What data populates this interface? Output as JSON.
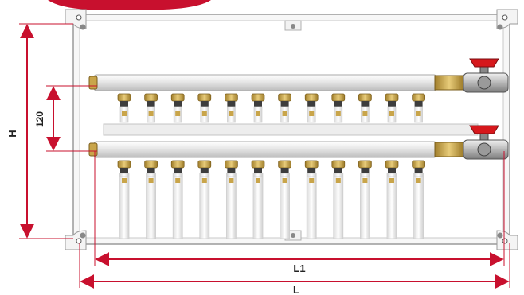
{
  "dimensions": {
    "height_label": "H",
    "spacing_label": "120",
    "inner_length_label": "L1",
    "overall_length_label": "L"
  },
  "colors": {
    "dimension_red": "#c8102e",
    "valve_handle_red": "#d6181c",
    "cabinet_border": "#8a8a8a",
    "manifold_bar": "#e9e9e9",
    "brass": "#c9a54a",
    "pipe_white": "#f2f2f2"
  },
  "counts": {
    "outlets_per_manifold": 12,
    "manifolds": 2,
    "ball_valves": 2
  }
}
